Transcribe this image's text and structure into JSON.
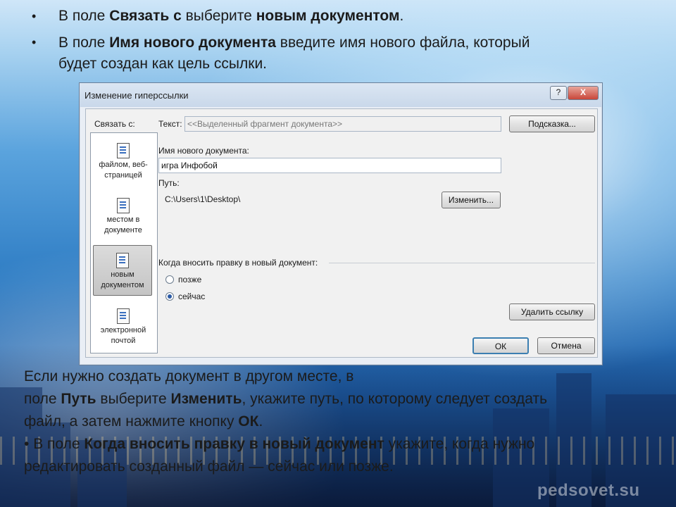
{
  "slide": {
    "bullet1": {
      "prefix": "В поле ",
      "b1": "Связать с",
      "mid": " выберите ",
      "b2": "новым документом",
      "suffix": "."
    },
    "bullet2": {
      "prefix": "В поле ",
      "b1": "Имя нового документа",
      "line1_rest": " введите имя нового файла, который",
      "line2": "будет создан как цель ссылки."
    },
    "para": {
      "line1": "Если нужно создать документ в другом месте, в",
      "line2_pre": "поле ",
      "line2_b1": "Путь",
      "line2_mid": " выберите ",
      "line2_b2": "Изменить",
      "line2_post": ", укажите путь, по которому следует создать",
      "line3_pre": "файл, а затем нажмите кнопку ",
      "line3_b": "ОК",
      "line3_post": "."
    },
    "bullet3": {
      "prefix": "В поле ",
      "b1": "Когда вносить правку в новый документ",
      "line1_rest": " укажите, когда нужно",
      "line2": "редактировать созданный файл — сейчас или позже."
    },
    "watermark": "pedsovet.su"
  },
  "dialog": {
    "title": "Изменение гиперссылки",
    "help": "?",
    "close": "X",
    "link_to_label": "Связать с:",
    "text_label": "Текст:",
    "text_value": "<<Выделенный фрагмент документа>>",
    "hint_button": "Подсказка...",
    "new_doc_label": "Имя нового документа:",
    "new_doc_value": "игра Инфобой",
    "path_label": "Путь:",
    "path_value": "C:\\Users\\1\\Desktop\\",
    "change_button": "Изменить...",
    "edit_group_label": "Когда вносить правку в новый документ:",
    "radio_later": "позже",
    "radio_now": "сейчас",
    "remove_link_button": "Удалить ссылку",
    "ok_button": "ОК",
    "cancel_button": "Отмена",
    "link_items": [
      {
        "line1": "файлом, веб-",
        "line2": "страницей"
      },
      {
        "line1": "местом в",
        "line2": "документе"
      },
      {
        "line1": "новым",
        "line2": "документом"
      },
      {
        "line1": "электронной",
        "line2": "почтой"
      }
    ],
    "selected_radio": "radio_now"
  }
}
